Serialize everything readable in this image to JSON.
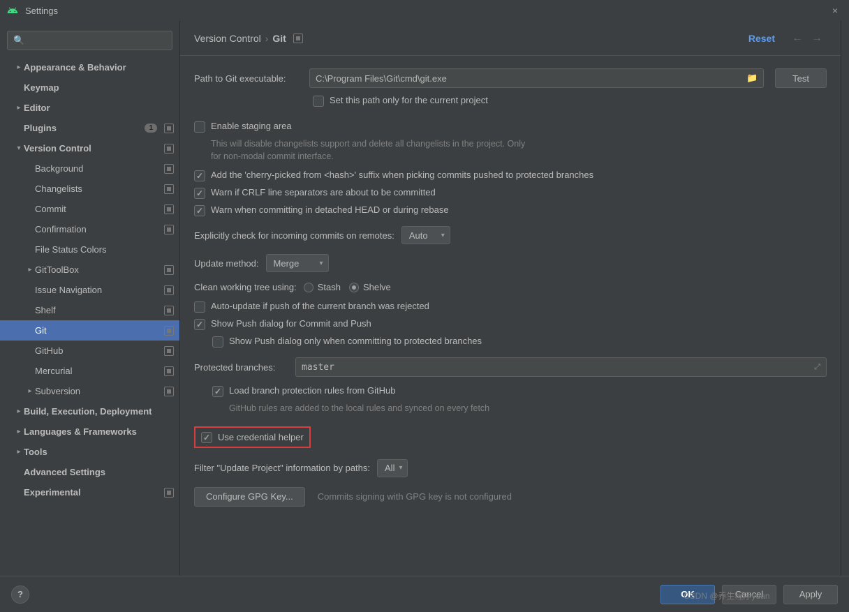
{
  "window": {
    "title": "Settings",
    "close": "×"
  },
  "sidebar": {
    "search_placeholder": "",
    "items": [
      {
        "label": "Appearance & Behavior",
        "type": "collapsed",
        "indent": 0,
        "bold": true
      },
      {
        "label": "Keymap",
        "type": "leaf",
        "indent": 0,
        "bold": true
      },
      {
        "label": "Editor",
        "type": "collapsed",
        "indent": 0,
        "bold": true
      },
      {
        "label": "Plugins",
        "type": "leaf",
        "indent": 0,
        "bold": true,
        "badge": "1",
        "postIcon": true
      },
      {
        "label": "Version Control",
        "type": "expanded",
        "indent": 0,
        "bold": true,
        "postIcon": true
      },
      {
        "label": "Background",
        "type": "leaf",
        "indent": 1,
        "postIcon": true
      },
      {
        "label": "Changelists",
        "type": "leaf",
        "indent": 1,
        "postIcon": true
      },
      {
        "label": "Commit",
        "type": "leaf",
        "indent": 1,
        "postIcon": true
      },
      {
        "label": "Confirmation",
        "type": "leaf",
        "indent": 1,
        "postIcon": true
      },
      {
        "label": "File Status Colors",
        "type": "leaf",
        "indent": 1
      },
      {
        "label": "GitToolBox",
        "type": "collapsed",
        "indent": 1,
        "postIcon": true
      },
      {
        "label": "Issue Navigation",
        "type": "leaf",
        "indent": 1,
        "postIcon": true
      },
      {
        "label": "Shelf",
        "type": "leaf",
        "indent": 1,
        "postIcon": true
      },
      {
        "label": "Git",
        "type": "leaf",
        "indent": 1,
        "postIcon": true,
        "selected": true
      },
      {
        "label": "GitHub",
        "type": "leaf",
        "indent": 1,
        "postIcon": true
      },
      {
        "label": "Mercurial",
        "type": "leaf",
        "indent": 1,
        "postIcon": true
      },
      {
        "label": "Subversion",
        "type": "collapsed",
        "indent": 1,
        "postIcon": true
      },
      {
        "label": "Build, Execution, Deployment",
        "type": "collapsed",
        "indent": 0,
        "bold": true
      },
      {
        "label": "Languages & Frameworks",
        "type": "collapsed",
        "indent": 0,
        "bold": true
      },
      {
        "label": "Tools",
        "type": "collapsed",
        "indent": 0,
        "bold": true
      },
      {
        "label": "Advanced Settings",
        "type": "leaf",
        "indent": 0,
        "bold": true
      },
      {
        "label": "Experimental",
        "type": "leaf",
        "indent": 0,
        "bold": true,
        "postIcon": true
      }
    ]
  },
  "header": {
    "bc1": "Version Control",
    "sep": "›",
    "bc2": "Git",
    "reset": "Reset"
  },
  "form": {
    "path_label": "Path to Git executable:",
    "path_value": "C:\\Program Files\\Git\\cmd\\git.exe",
    "test_btn": "Test",
    "set_path_current": "Set this path only for the current project",
    "enable_staging": "Enable staging area",
    "enable_staging_note": "This will disable changelists support and delete all changelists in the project. Only for non-modal commit interface.",
    "cherry_pick": "Add the 'cherry-picked from <hash>' suffix when picking commits pushed to protected branches",
    "warn_crlf": "Warn if CRLF line separators are about to be committed",
    "warn_detached": "Warn when committing in detached HEAD or during rebase",
    "explicit_check_label": "Explicitly check for incoming commits on remotes:",
    "explicit_check_value": "Auto",
    "update_method_label": "Update method:",
    "update_method_value": "Merge",
    "clean_tree_label": "Clean working tree using:",
    "stash": "Stash",
    "shelve": "Shelve",
    "auto_update": "Auto-update if push of the current branch was rejected",
    "show_push": "Show Push dialog for Commit and Push",
    "show_push_protected": "Show Push dialog only when committing to protected branches",
    "protected_label": "Protected branches:",
    "protected_value": "master",
    "load_branch_protection": "Load branch protection rules from GitHub",
    "load_branch_note": "GitHub rules are added to the local rules and synced on every fetch",
    "use_credential": "Use credential helper",
    "filter_paths_label": "Filter \"Update Project\" information by paths:",
    "filter_paths_value": "All",
    "configure_gpg": "Configure GPG Key...",
    "gpg_note": "Commits signing with GPG key is not configured"
  },
  "footer": {
    "help": "?",
    "ok": "OK",
    "cancel": "Cancel",
    "apply": "Apply",
    "watermark": "CSDN @养生程序yuan"
  }
}
